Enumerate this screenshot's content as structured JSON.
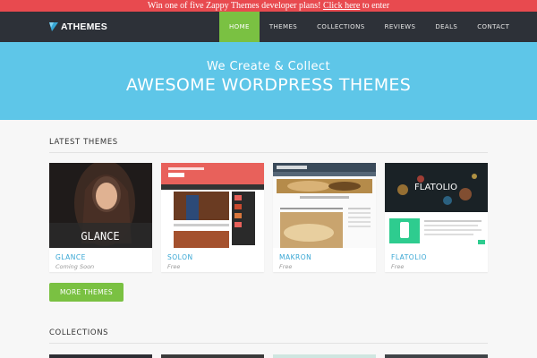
{
  "promo": {
    "text": "Win one of five Zappy Themes developer plans! ",
    "link": "Click here",
    "suffix": " to enter"
  },
  "header": {
    "logo": "ATHEMES",
    "nav": [
      "HOME",
      "THEMES",
      "COLLECTIONS",
      "REVIEWS",
      "DEALS",
      "CONTACT"
    ]
  },
  "hero": {
    "subtitle": "We Create & Collect",
    "title": "AWESOME WORDPRESS THEMES"
  },
  "latest": {
    "heading": "LATEST THEMES",
    "themes": [
      {
        "name": "GLANCE",
        "status": "Coming Soon",
        "overlay": "GLANCE"
      },
      {
        "name": "SOLON",
        "status": "Free"
      },
      {
        "name": "MAKRON",
        "status": "Free"
      },
      {
        "name": "FLATOLIO",
        "status": "Free",
        "overlay": "FLATOLIO"
      }
    ],
    "more_button": "MORE THEMES"
  },
  "collections": {
    "heading": "COLLECTIONS"
  },
  "colors": {
    "accent": "#7ac142",
    "promo": "#e84a4f",
    "nav": "#2d3138",
    "hero": "#5ec6e8",
    "link": "#37a6d4"
  }
}
